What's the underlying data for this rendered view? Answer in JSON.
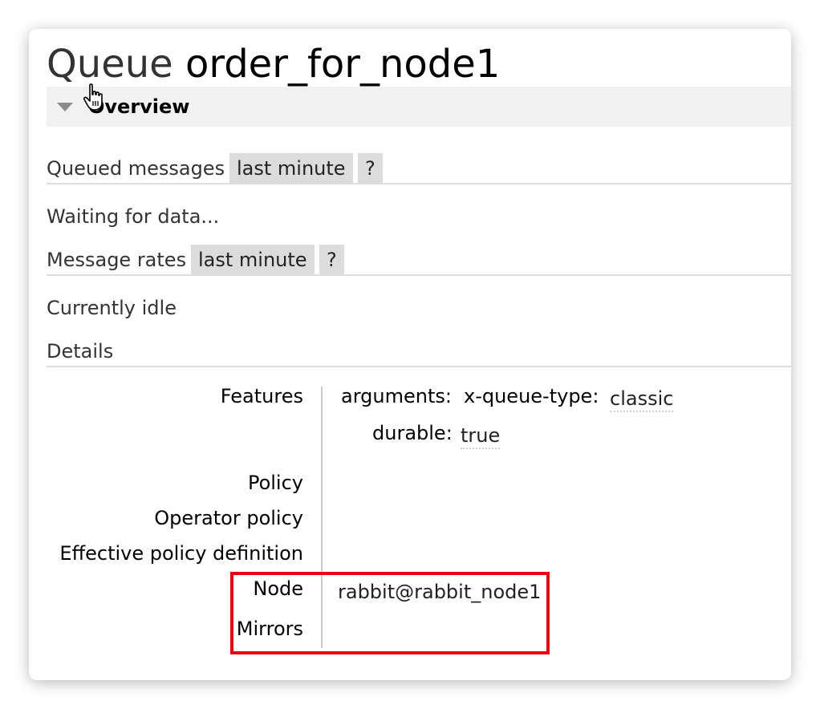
{
  "header": {
    "kind": "Queue",
    "name": "order_for_node1"
  },
  "overview": {
    "label": "Overview",
    "toggle_icon": "triangle-down-icon",
    "cursor_icon": "hand-pointer-icon"
  },
  "queued_messages": {
    "title": "Queued messages",
    "range": "last minute",
    "help": "?",
    "status": "Waiting for data..."
  },
  "message_rates": {
    "title": "Message rates",
    "range": "last minute",
    "help": "?",
    "status": "Currently idle"
  },
  "details": {
    "title": "Details",
    "features_label": "Features",
    "arguments_key": "arguments:",
    "queue_type_key": "x-queue-type:",
    "queue_type_value": "classic",
    "durable_key": "durable:",
    "durable_value": "true",
    "policy_label": "Policy",
    "operator_policy_label": "Operator policy",
    "effective_policy_label": "Effective policy definition",
    "node_label": "Node",
    "node_value": "rabbit@rabbit_node1",
    "mirrors_label": "Mirrors",
    "mirrors_value": ""
  },
  "colors": {
    "highlight": "#e8000b",
    "pill": "#dcdcdc",
    "section_bar": "#f1f1f1"
  }
}
